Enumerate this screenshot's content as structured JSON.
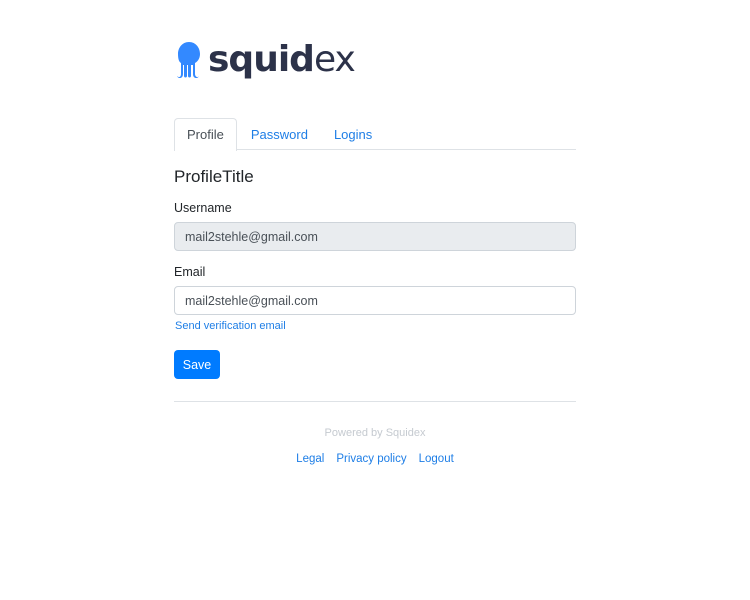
{
  "logo": {
    "text_left": "squi",
    "text_mid": "d",
    "text_right": "ex",
    "brand_color": "#3389ff",
    "text_color": "#2c3249"
  },
  "tabs": [
    {
      "label": "Profile",
      "active": true
    },
    {
      "label": "Password",
      "active": false
    },
    {
      "label": "Logins",
      "active": false
    }
  ],
  "profile": {
    "title": "ProfileTitle",
    "username_label": "Username",
    "username_value": "mail2stehle@gmail.com",
    "email_label": "Email",
    "email_value": "mail2stehle@gmail.com",
    "verify_link": "Send verification email",
    "save_label": "Save"
  },
  "footer": {
    "powered_by": "Powered by Squidex",
    "links": [
      "Legal",
      "Privacy policy",
      "Logout"
    ]
  },
  "colors": {
    "accent": "#007bff",
    "link": "#1e7ee6"
  }
}
